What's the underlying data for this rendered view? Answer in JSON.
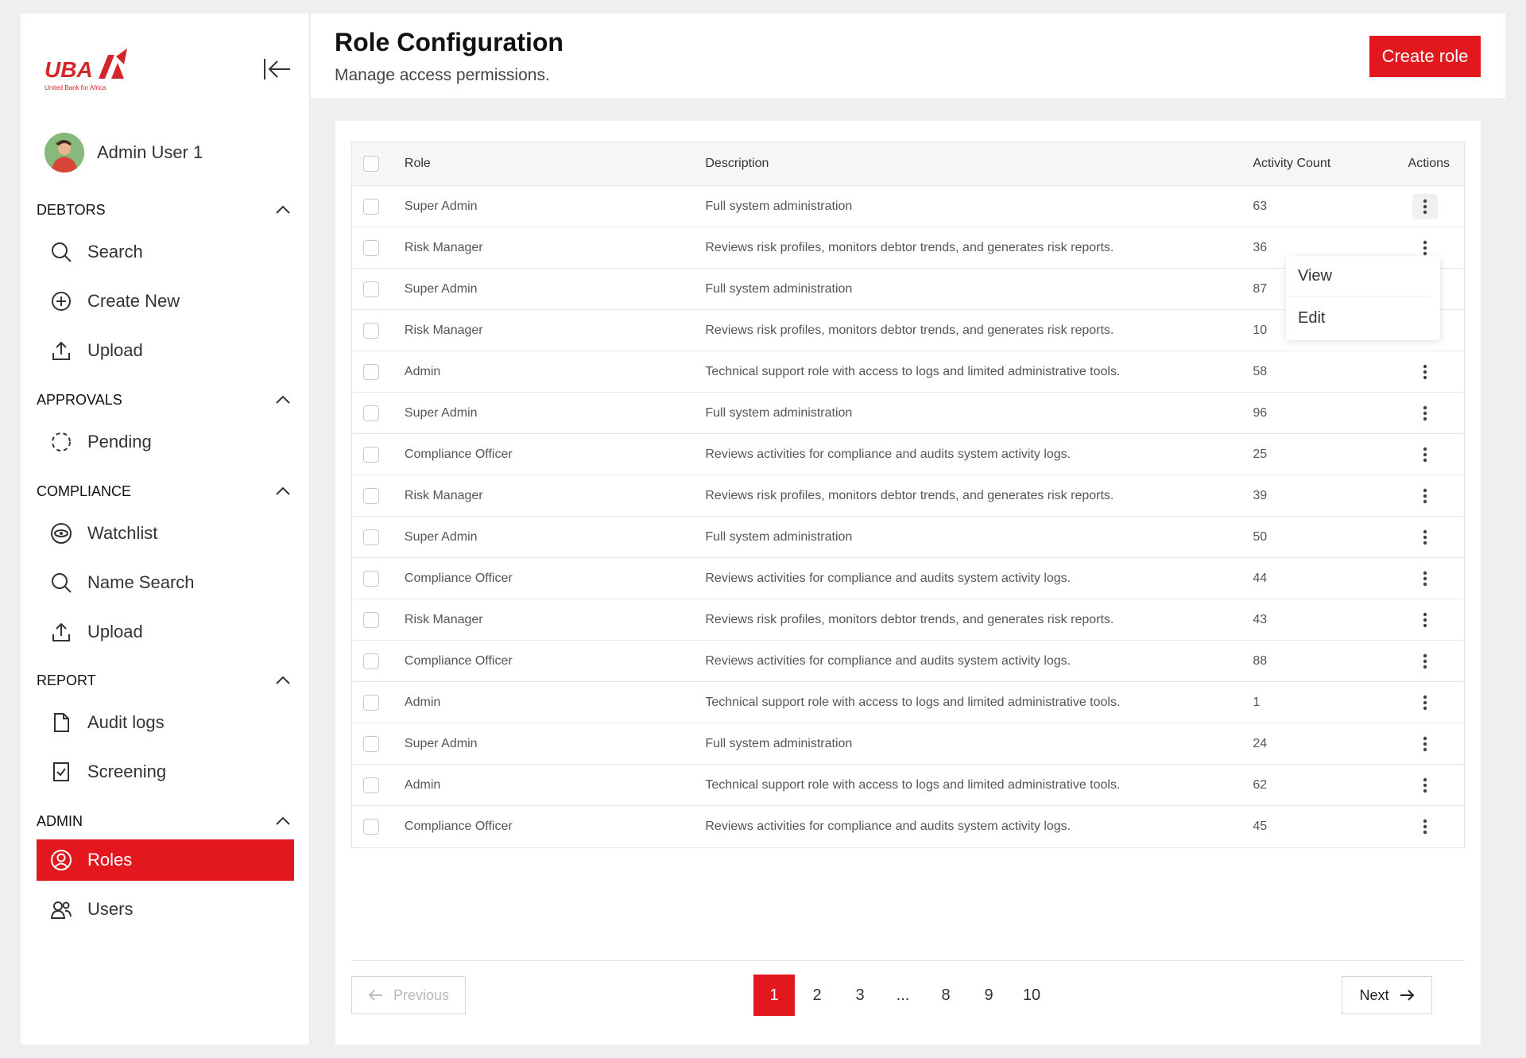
{
  "brand": {
    "name": "UBA",
    "tagline": "United Bank for Africa",
    "accent": "#e3181f"
  },
  "user": {
    "name": "Admin User 1"
  },
  "sidebar": {
    "sections": [
      {
        "title": "DEBTORS",
        "items": [
          {
            "label": "Search",
            "icon": "search-icon"
          },
          {
            "label": "Create New",
            "icon": "plus-circle-icon"
          },
          {
            "label": "Upload",
            "icon": "upload-icon"
          }
        ]
      },
      {
        "title": "APPROVALS",
        "items": [
          {
            "label": "Pending",
            "icon": "pending-icon"
          }
        ]
      },
      {
        "title": "COMPLIANCE",
        "items": [
          {
            "label": "Watchlist",
            "icon": "eye-icon"
          },
          {
            "label": "Name Search",
            "icon": "search-icon"
          },
          {
            "label": "Upload",
            "icon": "upload-icon"
          }
        ]
      },
      {
        "title": "REPORT",
        "items": [
          {
            "label": "Audit logs",
            "icon": "file-icon"
          },
          {
            "label": "Screening",
            "icon": "check-file-icon"
          }
        ]
      },
      {
        "title": "ADMIN",
        "items": [
          {
            "label": "Roles",
            "icon": "user-circle-icon",
            "active": true
          },
          {
            "label": "Users",
            "icon": "users-icon"
          }
        ]
      }
    ]
  },
  "header": {
    "title": "Role Configuration",
    "subtitle": "Manage access permissions.",
    "create_label": "Create role"
  },
  "table": {
    "columns": [
      "Role",
      "Description",
      "Activity Count",
      "Actions"
    ],
    "rows": [
      {
        "role": "Super Admin",
        "description": "Full system administration",
        "count": "63"
      },
      {
        "role": "Risk Manager",
        "description": "Reviews risk profiles, monitors debtor trends, and generates risk reports.",
        "count": "36"
      },
      {
        "role": "Super Admin",
        "description": "Full system administration",
        "count": "87"
      },
      {
        "role": "Risk Manager",
        "description": "Reviews risk profiles, monitors debtor trends, and generates risk reports.",
        "count": "10"
      },
      {
        "role": "Admin",
        "description": "Technical support role with access to logs and limited administrative tools.",
        "count": "58"
      },
      {
        "role": "Super Admin",
        "description": "Full system administration",
        "count": "96"
      },
      {
        "role": "Compliance Officer",
        "description": "Reviews activities for compliance and audits system activity logs.",
        "count": "25"
      },
      {
        "role": "Risk Manager",
        "description": "Reviews risk profiles, monitors debtor trends, and generates risk reports.",
        "count": "39"
      },
      {
        "role": "Super Admin",
        "description": "Full system administration",
        "count": "50"
      },
      {
        "role": "Compliance Officer",
        "description": "Reviews activities for compliance and audits system activity logs.",
        "count": "44"
      },
      {
        "role": "Risk Manager",
        "description": "Reviews risk profiles, monitors debtor trends, and generates risk reports.",
        "count": "43"
      },
      {
        "role": "Compliance Officer",
        "description": "Reviews activities for compliance and audits system activity logs.",
        "count": "88"
      },
      {
        "role": "Admin",
        "description": "Technical support role with access to logs and limited administrative tools.",
        "count": "1"
      },
      {
        "role": "Super Admin",
        "description": "Full system administration",
        "count": "24"
      },
      {
        "role": "Admin",
        "description": "Technical support role with access to logs and limited administrative tools.",
        "count": "62"
      },
      {
        "role": "Compliance Officer",
        "description": "Reviews activities for compliance and audits system activity logs.",
        "count": "45"
      }
    ]
  },
  "row_menu": {
    "view_label": "View",
    "edit_label": "Edit"
  },
  "pagination": {
    "previous_label": "Previous",
    "next_label": "Next",
    "pages": [
      "1",
      "2",
      "3",
      "...",
      "8",
      "9",
      "10"
    ],
    "current": "1"
  }
}
